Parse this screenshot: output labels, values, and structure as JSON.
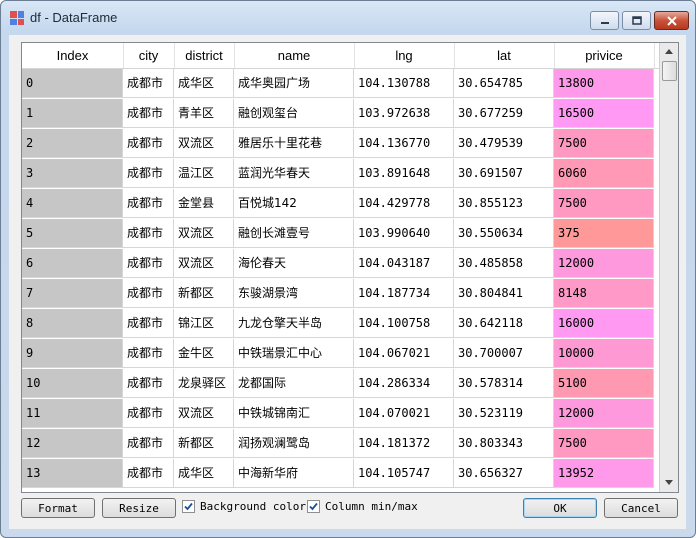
{
  "window": {
    "title": "df - DataFrame"
  },
  "columns": [
    "Index",
    "city",
    "district",
    "name",
    "lng",
    "lat",
    "privice"
  ],
  "rows": [
    {
      "index": "0",
      "city": "成都市",
      "district": "成华区",
      "name": "成华奥园广场",
      "lng": "104.130788",
      "lat": "30.654785",
      "privice": "13800",
      "color": "#ff99ea"
    },
    {
      "index": "1",
      "city": "成都市",
      "district": "青羊区",
      "name": "融创观玺台",
      "lng": "103.972638",
      "lat": "30.677259",
      "privice": "16500",
      "color": "#ff99f4"
    },
    {
      "index": "2",
      "city": "成都市",
      "district": "双流区",
      "name": "雅居乐十里花巷",
      "lng": "104.136770",
      "lat": "30.479539",
      "privice": "7500",
      "color": "#ff99c2"
    },
    {
      "index": "3",
      "city": "成都市",
      "district": "温江区",
      "name": "蓝润光华春天",
      "lng": "103.891648",
      "lat": "30.691507",
      "privice": "6060",
      "color": "#ff99b6"
    },
    {
      "index": "4",
      "city": "成都市",
      "district": "金堂县",
      "name": "百悦城142",
      "lng": "104.429778",
      "lat": "30.855123",
      "privice": "7500",
      "color": "#ff99c2"
    },
    {
      "index": "5",
      "city": "成都市",
      "district": "双流区",
      "name": "融创长滩壹号",
      "lng": "103.990640",
      "lat": "30.550634",
      "privice": "375",
      "color": "#ff9999"
    },
    {
      "index": "6",
      "city": "成都市",
      "district": "双流区",
      "name": "海伦春天",
      "lng": "104.043187",
      "lat": "30.485858",
      "privice": "12000",
      "color": "#ff99dd"
    },
    {
      "index": "7",
      "city": "成都市",
      "district": "新都区",
      "name": "东骏湖景湾",
      "lng": "104.187734",
      "lat": "30.804841",
      "privice": "8148",
      "color": "#ff99c8"
    },
    {
      "index": "8",
      "city": "成都市",
      "district": "锦江区",
      "name": "九龙仓擎天半岛",
      "lng": "104.100758",
      "lat": "30.642118",
      "privice": "16000",
      "color": "#ff99f1"
    },
    {
      "index": "9",
      "city": "成都市",
      "district": "金牛区",
      "name": "中铁瑞景汇中心",
      "lng": "104.067021",
      "lat": "30.700007",
      "privice": "10000",
      "color": "#ff99d4"
    },
    {
      "index": "10",
      "city": "成都市",
      "district": "龙泉驿区",
      "name": "龙都国际",
      "lng": "104.286334",
      "lat": "30.578314",
      "privice": "5100",
      "color": "#ff99b2"
    },
    {
      "index": "11",
      "city": "成都市",
      "district": "双流区",
      "name": "中铁城锦南汇",
      "lng": "104.070021",
      "lat": "30.523119",
      "privice": "12000",
      "color": "#ff99dd"
    },
    {
      "index": "12",
      "city": "成都市",
      "district": "新都区",
      "name": "润扬观澜鹭岛",
      "lng": "104.181372",
      "lat": "30.803343",
      "privice": "7500",
      "color": "#ff99c2"
    },
    {
      "index": "13",
      "city": "成都市",
      "district": "成华区",
      "name": "中海新华府",
      "lng": "104.105747",
      "lat": "30.656327",
      "privice": "13952",
      "color": "#ff99e9"
    }
  ],
  "buttons": {
    "format": "Format",
    "resize": "Resize",
    "ok": "OK",
    "cancel": "Cancel"
  },
  "checkboxes": {
    "background_color": {
      "label": "Background color",
      "checked": true
    },
    "column_minmax": {
      "label": "Column min/max",
      "checked": true
    }
  },
  "icons": {
    "minimize": "minimize-icon",
    "maximize": "maximize-icon",
    "close": "close-icon",
    "app": "grid-app-icon",
    "check": "checkmark-icon",
    "scroll_up": "chevron-up-icon",
    "scroll_down": "chevron-down-icon"
  }
}
